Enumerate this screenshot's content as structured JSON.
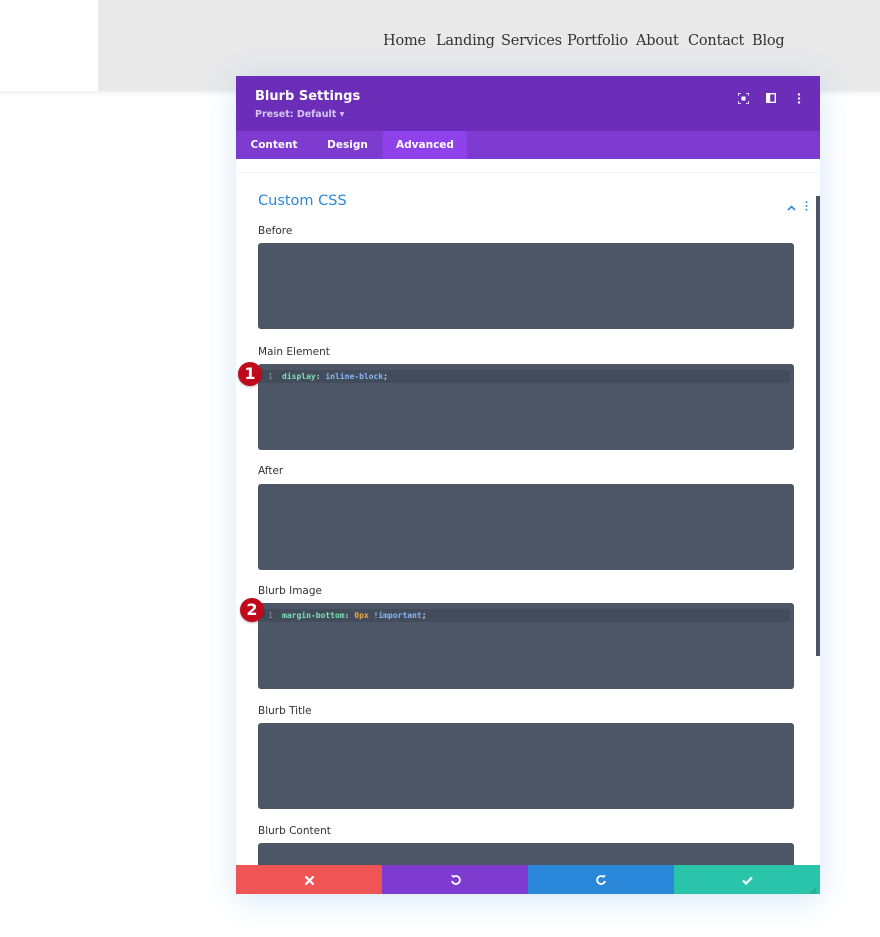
{
  "site_nav": {
    "items": [
      {
        "label": "Home"
      },
      {
        "label": "Landing"
      },
      {
        "label": "Services"
      },
      {
        "label": "Portfolio"
      },
      {
        "label": "About"
      },
      {
        "label": "Contact"
      },
      {
        "label": "Blog"
      }
    ]
  },
  "modal": {
    "title": "Blurb Settings",
    "preset": "Preset: Default ▾",
    "header_icons": [
      "focus-mode-icon",
      "split-view-icon",
      "more-options-icon"
    ],
    "tabs": [
      {
        "label": "Content",
        "active": false
      },
      {
        "label": "Design",
        "active": false
      },
      {
        "label": "Advanced",
        "active": true
      }
    ],
    "section": {
      "title": "Custom CSS",
      "expanded": true
    },
    "fields": [
      {
        "label": "Before",
        "code": ""
      },
      {
        "label": "Main Element",
        "line_number": "1",
        "code_prop": "display",
        "code_value": "inline-block",
        "badge": "1"
      },
      {
        "label": "After",
        "code": ""
      },
      {
        "label": "Blurb Image",
        "line_number": "1",
        "code_prop": "margin-bottom",
        "code_num": "0px",
        "code_value": "!important",
        "badge": "2"
      },
      {
        "label": "Blurb Title",
        "code": ""
      },
      {
        "label": "Blurb Content",
        "code": ""
      }
    ],
    "footer": {
      "cancel_icon": "✖",
      "undo_icon": "↺",
      "redo_icon": "↻",
      "save_icon": "✔"
    },
    "colors": {
      "header": "#6c2eb9",
      "tabs": "#7e3bd0",
      "active_tab": "#8f42ec",
      "section_title": "#2b87da",
      "cancel": "#ef5555",
      "undo": "#7e3bd0",
      "redo": "#2b87da",
      "save": "#29c4a9"
    }
  }
}
